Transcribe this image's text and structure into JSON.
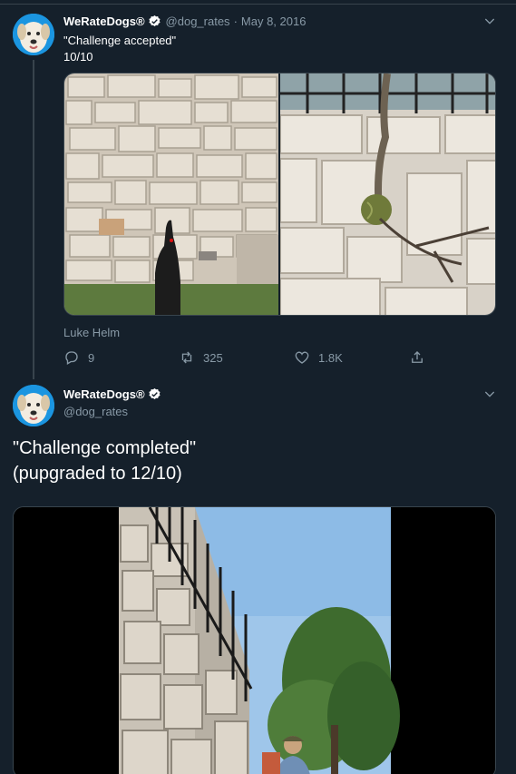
{
  "tweet1": {
    "display_name": "WeRateDogs®",
    "handle": "@dog_rates",
    "separator": "·",
    "date": "May 8, 2016",
    "text_line1": "\"Challenge accepted\"",
    "text_line2": "10/10",
    "attribution": "Luke Helm",
    "replies": "9",
    "retweets": "325",
    "likes": "1.8K"
  },
  "tweet2": {
    "display_name": "WeRateDogs®",
    "handle": "@dog_rates",
    "text_line1": "\"Challenge completed\"",
    "text_line2": "(pupgraded to 12/10)"
  },
  "colors": {
    "background": "#15202b",
    "border": "#38444d",
    "secondary_text": "#8899a6",
    "verified": "#ffffff"
  },
  "icons": [
    "verified-icon",
    "chevron-down-icon",
    "reply-icon",
    "retweet-icon",
    "like-icon",
    "share-icon"
  ]
}
